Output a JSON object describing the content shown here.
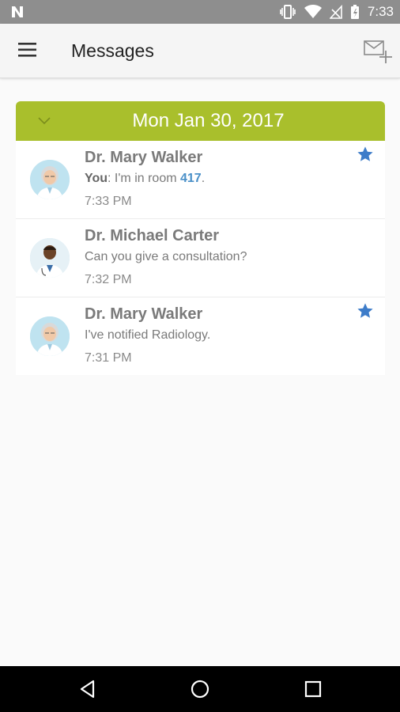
{
  "status_bar": {
    "time": "7:33"
  },
  "app_bar": {
    "title": "Messages"
  },
  "date_header": {
    "label": "Mon Jan 30, 2017"
  },
  "messages": [
    {
      "name": "Dr. Mary Walker",
      "sender_prefix": "You",
      "text_before": ": I'm in room ",
      "highlight": "417",
      "text_after": ".",
      "time": "7:33 PM",
      "starred": true
    },
    {
      "name": "Dr. Michael Carter",
      "text": "Can you give a consultation?",
      "time": "7:32 PM",
      "starred": false
    },
    {
      "name": "Dr. Mary Walker",
      "text": "I've notified Radiology.",
      "time": "7:31 PM",
      "starred": true
    }
  ],
  "colors": {
    "accent_green": "#a9bf2c",
    "star_blue": "#3d7cc9",
    "status_bar": "#8e8e8e"
  },
  "icons": [
    "n-notification-icon",
    "vibrate-icon",
    "wifi-icon",
    "no-signal-icon",
    "battery-icon",
    "menu-icon",
    "compose-message-icon",
    "chevron-down-icon",
    "star-icon",
    "back-icon",
    "home-icon",
    "recents-icon"
  ]
}
